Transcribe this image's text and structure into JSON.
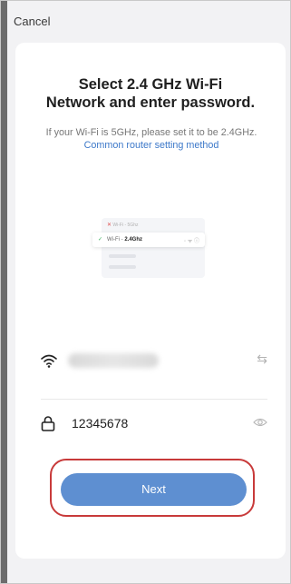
{
  "header": {
    "cancel_label": "Cancel"
  },
  "main": {
    "title_line1": "Select 2.4 GHz Wi-Fi",
    "title_line2": "Network and enter password.",
    "subtitle_text": "If your Wi-Fi is 5GHz, please set it to be 2.4GHz. ",
    "subtitle_link": "Common router setting method"
  },
  "illustration": {
    "row1_label": "Wi-Fi - 5Ghz",
    "row2_prefix": "Wi-Fi - ",
    "row2_bold": "2.4Ghz"
  },
  "wifi": {
    "ssid_hidden": true
  },
  "password": {
    "value": "12345678"
  },
  "actions": {
    "next_label": "Next"
  },
  "icons": {
    "wifi": "wifi-icon",
    "swap": "swap-icon",
    "lock": "lock-icon",
    "eye": "eye-icon"
  },
  "colors": {
    "primary_button": "#5e8fd1",
    "highlight_outline": "#c83a3a",
    "link": "#3c78c9",
    "background": "#f2f2f4"
  }
}
